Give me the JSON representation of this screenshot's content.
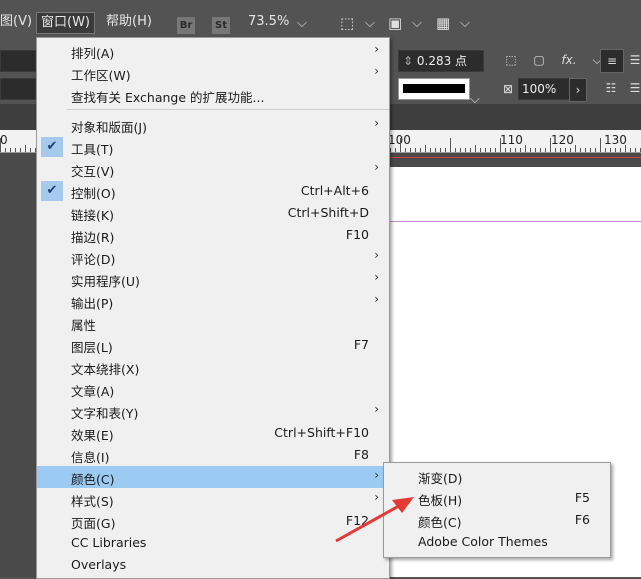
{
  "menubar": {
    "items": [
      "图(V)",
      "窗口(W)",
      "帮助(H)"
    ],
    "app_icons": [
      "Br",
      "St"
    ],
    "zoom": "73.5%"
  },
  "control": {
    "stroke_weight": "0.283 点",
    "opacity": "100%",
    "fx_label": "fx."
  },
  "ruler": {
    "labels": [
      "0",
      "100",
      "110",
      "120",
      "130"
    ]
  },
  "menu": {
    "items": [
      {
        "label": "排列(A)",
        "submenu": true
      },
      {
        "label": "工作区(W)",
        "submenu": true
      },
      {
        "label": "查找有关 Exchange 的扩展功能..."
      },
      {
        "label": "对象和版面(J)",
        "submenu": true
      },
      {
        "label": "工具(T)",
        "checked": true
      },
      {
        "label": "交互(V)",
        "submenu": true
      },
      {
        "label": "控制(O)",
        "checked": true,
        "shortcut": "Ctrl+Alt+6"
      },
      {
        "label": "链接(K)",
        "shortcut": "Ctrl+Shift+D"
      },
      {
        "label": "描边(R)",
        "shortcut": "F10"
      },
      {
        "label": "评论(D)",
        "submenu": true
      },
      {
        "label": "实用程序(U)",
        "submenu": true
      },
      {
        "label": "输出(P)",
        "submenu": true
      },
      {
        "label": "属性"
      },
      {
        "label": "图层(L)",
        "shortcut": "F7"
      },
      {
        "label": "文本绕排(X)"
      },
      {
        "label": "文章(A)"
      },
      {
        "label": "文字和表(Y)",
        "submenu": true
      },
      {
        "label": "效果(E)",
        "shortcut": "Ctrl+Shift+F10"
      },
      {
        "label": "信息(I)",
        "shortcut": "F8"
      },
      {
        "label": "颜色(C)",
        "submenu": true,
        "highlighted": true
      },
      {
        "label": "样式(S)",
        "submenu": true
      },
      {
        "label": "页面(G)",
        "shortcut": "F12"
      },
      {
        "label": "CC Libraries"
      },
      {
        "label": "Overlays"
      }
    ]
  },
  "submenu": {
    "items": [
      {
        "label": "渐变(D)",
        "shortcut": ""
      },
      {
        "label": "色板(H)",
        "shortcut": "F5"
      },
      {
        "label": "颜色(C)",
        "shortcut": "F6"
      },
      {
        "label": "Adobe Color Themes",
        "shortcut": ""
      }
    ]
  },
  "colors": {
    "highlight": "#9bcaf3",
    "annotation_arrow": "#e53935"
  }
}
